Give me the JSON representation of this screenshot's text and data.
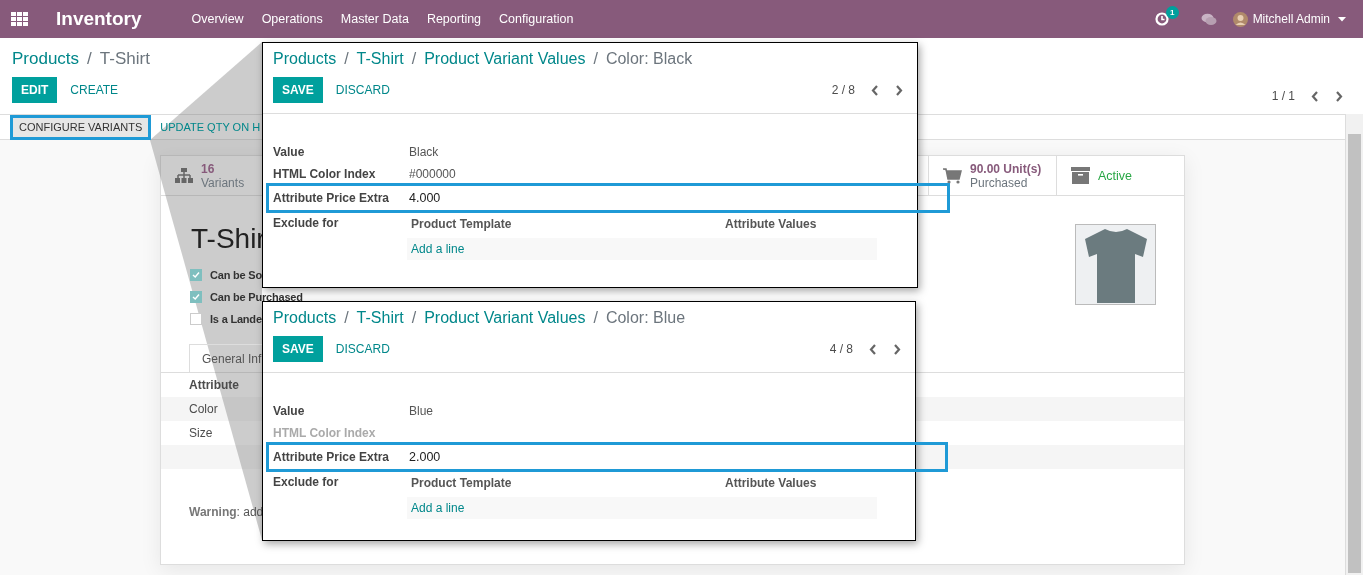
{
  "navbar": {
    "app_name": "Inventory",
    "menu": [
      "Overview",
      "Operations",
      "Master Data",
      "Reporting",
      "Configuration"
    ],
    "activity_badge": "1",
    "user": "Mitchell Admin"
  },
  "control_panel": {
    "separator": "/",
    "breadcrumbs": [
      "Products",
      "T-Shirt"
    ],
    "buttons": [
      {
        "label": "EDIT",
        "kind": "primary"
      },
      {
        "label": "CREATE",
        "kind": "link"
      }
    ],
    "pager": "1 / 1"
  },
  "status_buttons": [
    {
      "label": "CONFIGURE VARIANTS",
      "highlighted": true
    },
    {
      "label": "UPDATE QTY ON H",
      "highlighted": false
    }
  ],
  "sheet": {
    "stat_buttons": [
      {
        "kind": "variants",
        "value": "16",
        "label": "Variants"
      },
      {
        "kind": "purchased",
        "value": "90.00 Unit(s)",
        "label": "Purchased"
      },
      {
        "kind": "archive",
        "value": "Active"
      }
    ],
    "title": "T-Shir",
    "checkboxes": [
      {
        "label": "Can be So",
        "checked": true
      },
      {
        "label": "Can be Purchased",
        "checked": true
      },
      {
        "label": "Is a Lande",
        "checked": false
      }
    ],
    "tabs": [
      {
        "label": "General Inf",
        "selected": true
      }
    ],
    "table": {
      "columns": [
        "Attribute"
      ],
      "rows": [
        "Color",
        "Size"
      ]
    },
    "warning": "**Warning**: add"
  },
  "dialogs": [
    {
      "separator": "/",
      "breadcrumbs": [
        "Products",
        "T-Shirt",
        "Product Variant Values",
        "Color: Black"
      ],
      "buttons": [
        {
          "label": "SAVE",
          "kind": "primary"
        },
        {
          "label": "DISCARD",
          "kind": "link"
        }
      ],
      "pager": "2 / 8",
      "fields": [
        {
          "label": "Value",
          "value": "Black",
          "label_muted": false,
          "highlighted": false
        },
        {
          "label": "HTML Color Index",
          "value": "#000000",
          "label_muted": false,
          "highlighted": false
        },
        {
          "label": "Attribute Price Extra",
          "value": "4.000",
          "label_muted": false,
          "highlighted": true
        }
      ],
      "exclude_for": {
        "label": "Exclude for",
        "columns": [
          "Product Template",
          "Attribute Values"
        ],
        "add_line": "Add a line"
      }
    },
    {
      "separator": "/",
      "breadcrumbs": [
        "Products",
        "T-Shirt",
        "Product Variant Values",
        "Color: Blue"
      ],
      "buttons": [
        {
          "label": "SAVE",
          "kind": "primary"
        },
        {
          "label": "DISCARD",
          "kind": "link"
        }
      ],
      "pager": "4 / 8",
      "fields": [
        {
          "label": "Value",
          "value": "Blue",
          "label_muted": false,
          "highlighted": false
        },
        {
          "label": "HTML Color Index",
          "label_muted": true,
          "highlighted": false
        },
        {
          "label": "Attribute Price Extra",
          "value": "2.000",
          "label_muted": false,
          "highlighted": true
        }
      ],
      "exclude_for": {
        "label": "Exclude for",
        "columns": [
          "Product Template",
          "Attribute Values"
        ],
        "add_line": "Add a line"
      }
    }
  ]
}
